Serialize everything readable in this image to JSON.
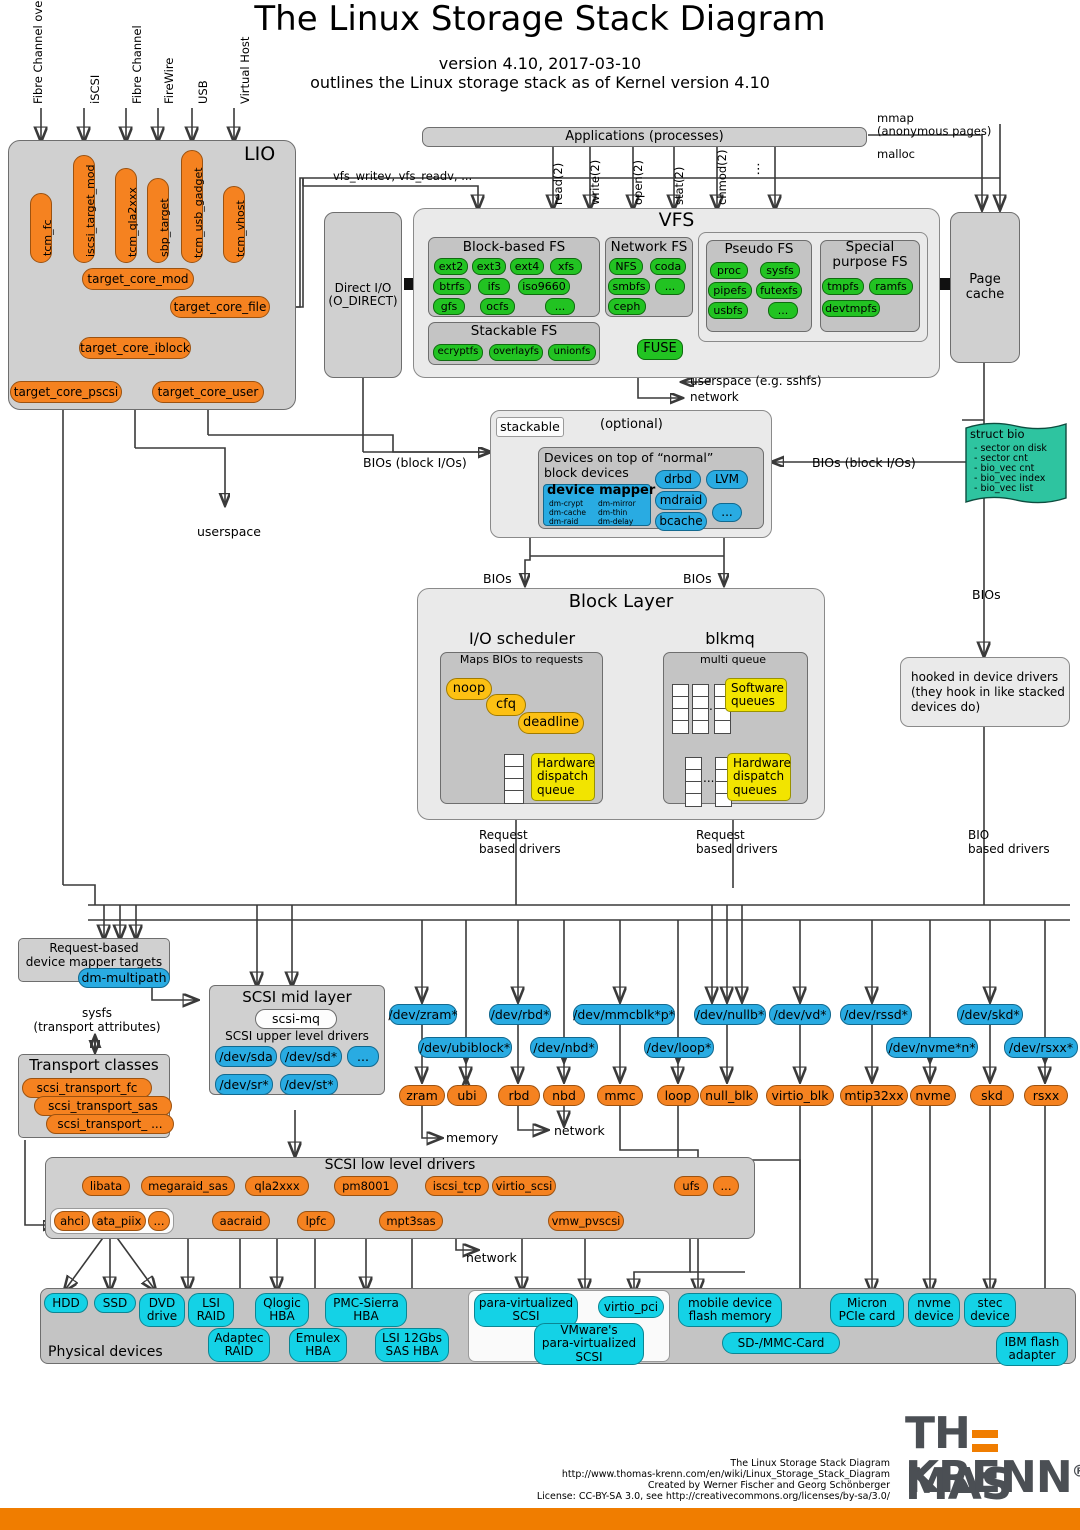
{
  "header": {
    "title": "The Linux Storage Stack Diagram",
    "version": "version 4.10, 2017-03-10",
    "subtitle": "outlines the Linux storage stack as of Kernel version 4.10"
  },
  "colors": {
    "orange": "#f58220",
    "green": "#22c322",
    "blue": "#29abe2",
    "cyan": "#14d2e6",
    "yellow": "#f2e400",
    "amber": "#fcc013",
    "grey": "#d0d0d0",
    "teal_note": "#2ec4a0",
    "brand_orange": "#f07d00",
    "brand_grey": "#4b4f54"
  },
  "transports": [
    "Fibre Channel\nover Ethernet",
    "iSCSI",
    "Fibre Channel",
    "FireWire",
    "USB",
    "Virtual Host"
  ],
  "lio": {
    "title": "LIO",
    "frontends": [
      "tcm_fc",
      "iscsi_target_mod",
      "tcm_qla2xxx",
      "sbp_target",
      "tcm_usb_gadget",
      "tcm_vhost"
    ],
    "core": "target_core_mod",
    "backends": [
      "target_core_file",
      "target_core_iblock",
      "target_core_pscsi",
      "target_core_user"
    ]
  },
  "applications": {
    "label": "Applications (processes)",
    "syscalls": [
      "read(2)",
      "write(2)",
      "open(2)",
      "stat(2)",
      "chmod(2)",
      "⋮"
    ],
    "vfs_helpers": "vfs_writev, vfs_readv, ...",
    "mmap": "mmap\n(anonymous pages)",
    "malloc": "malloc"
  },
  "direct_io": {
    "label": "Direct I/O\n(O_DIRECT)"
  },
  "page_cache": {
    "label": "Page\ncache"
  },
  "vfs": {
    "title": "VFS",
    "groups": [
      {
        "title": "Block-based FS",
        "items": [
          "ext2",
          "ext3",
          "ext4",
          "xfs",
          "btrfs",
          "ifs",
          "iso9660",
          "gfs",
          "ocfs",
          "..."
        ]
      },
      {
        "title": "Network FS",
        "items": [
          "NFS",
          "coda",
          "smbfs",
          "...",
          "ceph"
        ]
      },
      {
        "title": "Pseudo FS",
        "items": [
          "proc",
          "sysfs",
          "pipefs",
          "futexfs",
          "usbfs",
          "..."
        ]
      },
      {
        "title": "Special\npurpose FS",
        "items": [
          "tmpfs",
          "ramfs",
          "devtmpfs"
        ]
      },
      {
        "title": "Stackable FS",
        "items": [
          "ecryptfs",
          "overlayfs",
          "unionfs"
        ]
      }
    ],
    "fuse": "FUSE",
    "fuse_targets": [
      "userspace (e.g. sshfs)",
      "network"
    ]
  },
  "stackable": {
    "tag": "stackable",
    "optional": "(optional)",
    "title": "Devices on top of “normal”\nblock devices",
    "dm_title": "device mapper",
    "dm_items": [
      "dm-crypt",
      "dm-mirror",
      "dm-cache",
      "dm-thin",
      "dm-raid",
      "dm-delay"
    ],
    "others": [
      "drbd",
      "LVM",
      "mdraid",
      "bcache",
      "..."
    ]
  },
  "struct_bio": {
    "title": "struct bio",
    "fields": [
      "- sector on disk",
      "- sector cnt",
      "- bio_vec cnt",
      "- bio_vec index",
      "- bio_vec list"
    ]
  },
  "hooked": {
    "label": "hooked in device drivers\n(they hook in like stacked\ndevices do)"
  },
  "block_layer": {
    "title": "Block Layer",
    "io_scheduler": {
      "title": "I/O scheduler",
      "caption": "Maps BIOs to requests",
      "schedulers": [
        "noop",
        "cfq",
        "deadline"
      ],
      "queue_label": "Hardware\ndispatch\nqueue"
    },
    "blkmq": {
      "title": "blkmq",
      "caption": "multi queue",
      "sw_label": "Software\nqueues",
      "hw_label": "Hardware\ndispatch\nqueues",
      "ellipsis": "..."
    }
  },
  "edge_labels": {
    "bios_block_ios_left": "BIOs (block I/Os)",
    "bios_block_ios_right": "BIOs (block I/Os)",
    "bios_left": "BIOs",
    "bios_right": "BIOs",
    "bios_far_right": "BIOs",
    "userspace": "userspace",
    "request_based_1": "Request\nbased drivers",
    "request_based_2": "Request\nbased drivers",
    "bio_based": "BIO\nbased drivers",
    "memory": "memory",
    "network_dev": "network",
    "network_scsi": "network",
    "sysfs": "sysfs\n(transport attributes)"
  },
  "dm_targets": {
    "title": "Request-based\ndevice mapper targets",
    "item": "dm-multipath"
  },
  "transport_classes": {
    "title": "Transport classes",
    "items": [
      "scsi_transport_fc",
      "scsi_transport_sas",
      "scsi_transport_ ..."
    ]
  },
  "scsi_mid": {
    "title": "SCSI mid layer",
    "scsi_mq": "scsi-mq",
    "upper_title": "SCSI upper level drivers",
    "devices": [
      "/dev/sda",
      "/dev/sd*",
      "...",
      "/dev/sr*",
      "/dev/st*"
    ]
  },
  "block_devices": {
    "row1": [
      "/dev/zram*",
      "/dev/rbd*",
      "/dev/mmcblk*p*",
      "/dev/nullb*",
      "/dev/vd*",
      "/dev/rssd*",
      "/dev/skd*"
    ],
    "row2": [
      "/dev/ubiblock*",
      "/dev/nbd*",
      "/dev/loop*",
      "/dev/nvme*n*",
      "/dev/rsxx*"
    ],
    "drivers": [
      "zram",
      "ubi",
      "rbd",
      "nbd",
      "mmc",
      "loop",
      "null_blk",
      "virtio_blk",
      "mtip32xx",
      "nvme",
      "skd",
      "rsxx"
    ]
  },
  "scsi_low": {
    "title": "SCSI low level drivers",
    "row1": [
      "libata",
      "megaraid_sas",
      "qla2xxx",
      "pm8001",
      "iscsi_tcp",
      "virtio_scsi",
      "ufs",
      "..."
    ],
    "libata_children": [
      "ahci",
      "ata_piix",
      "..."
    ],
    "row2": [
      "aacraid",
      "lpfc",
      "mpt3sas",
      "vmw_pvscsi"
    ]
  },
  "physical": {
    "title": "Physical devices",
    "row1": [
      "HDD",
      "SSD",
      "DVD\ndrive",
      "LSI\nRAID",
      "Qlogic\nHBA",
      "PMC-Sierra\nHBA"
    ],
    "row2": [
      "Adaptec\nRAID",
      "Emulex\nHBA",
      "LSI 12Gbs\nSAS HBA"
    ],
    "virt": [
      "para-virtualized\nSCSI",
      "virtio_pci",
      "VMware's\npara-virtualized\nSCSI"
    ],
    "right1": [
      "mobile device\nflash memory",
      "Micron\nPCIe card",
      "nvme\ndevice",
      "stec\ndevice"
    ],
    "right2": [
      "SD-/MMC-Card",
      "IBM flash\nadapter"
    ]
  },
  "footer": {
    "line1": "The Linux Storage Stack Diagram",
    "line2": "http://www.thomas-krenn.com/en/wiki/Linux_Storage_Stack_Diagram",
    "line3": "Created by Werner Fischer and Georg Schönberger",
    "line4": "License: CC-BY-SA 3.0, see http://creativecommons.org/licenses/by-sa/3.0/",
    "brand_top": "TH",
    "brand_top2": "MAS",
    "brand_bottom": "KRENN",
    "brand_reg": "®"
  }
}
